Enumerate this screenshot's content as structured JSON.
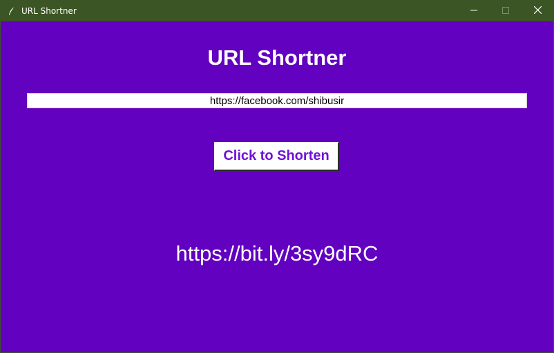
{
  "window": {
    "title": "URL Shortner",
    "title_bar_color": "#3c5524",
    "background_color": "#6201c0"
  },
  "icons": {
    "app": "feather-icon",
    "minimize": "minimize-icon",
    "maximize": "maximize-icon",
    "close": "close-icon"
  },
  "main": {
    "heading": "URL Shortner",
    "url_input_value": "https://facebook.com/shibusir",
    "shorten_button_label": "Click to Shorten",
    "shortened_result": "https://bit.ly/3sy9dRC",
    "button_text_color": "#6f11d6"
  }
}
